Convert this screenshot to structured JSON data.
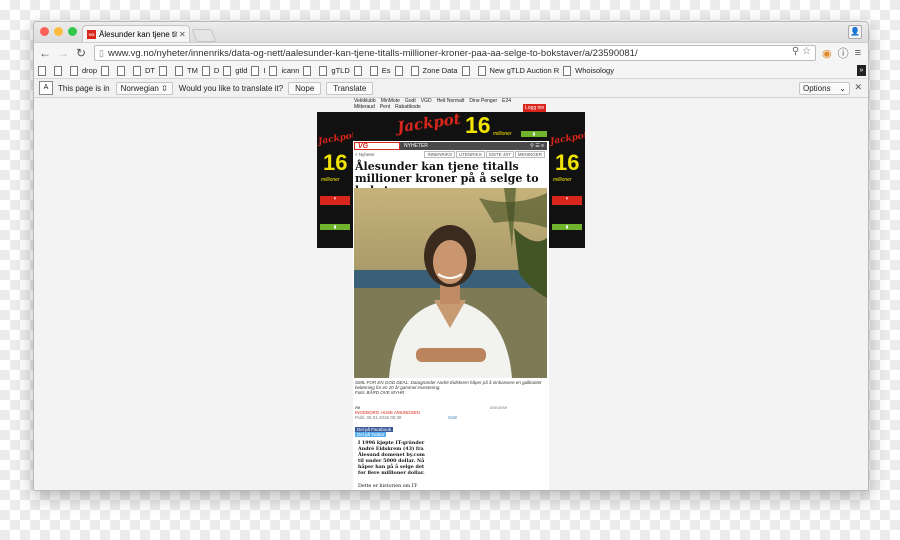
{
  "browser": {
    "tab_title": "Ålesunder kan tjene titalls",
    "tab_favicon": "VG",
    "url": "www.vg.no/nyheter/innenriks/data-og-nett/aalesunder-kan-tjene-titalls-millioner-kroner-paa-aa-selge-to-bokstaver/a/23590081/",
    "bookmarks": [
      "drop",
      "DT",
      "TM",
      "D",
      "gtld",
      "I",
      "icann",
      "gTLD",
      "Es",
      "Zone Data",
      "New gTLD Auction R",
      "Whoisology"
    ]
  },
  "translate_bar": {
    "prefix": "This page is in",
    "language": "Norwegian",
    "question": "Would you like to translate it?",
    "nope": "Nope",
    "translate": "Translate",
    "options": "Options"
  },
  "vg_top": {
    "row1": [
      "Vektklubb",
      "MinMote",
      "Godt",
      "VGD",
      "Helt Normalt",
      "Dine Penger",
      "E24"
    ],
    "row2": [
      "Mitteraud",
      "Pent",
      "Rabattkode"
    ],
    "login": "Logg inn"
  },
  "ad": {
    "jackpot": "Jackpot",
    "amount": "16",
    "unit": "millioner",
    "side_amount": "16",
    "side_unit": "millioner"
  },
  "article": {
    "section": "NYHETER",
    "back": "< Nyheter",
    "tabs": [
      "INNENRIKS",
      "UTENRIKS",
      "SISTE 48T",
      "MENINGER"
    ],
    "headline": "Ålesunder kan tjene titalls millioner kroner på å selge to bokstaver",
    "caption": "SMIL FOR EN GOD DEAL: Datagründer André Eidskrem håper på å innkassere en gullkantet belønning for en 20 år gammel investering.",
    "photo_credit": "Foto: BÅRD OVE MYHR",
    "byline_prefix": "Av",
    "author": "INGEBORG HUSE AMUNDSEN",
    "date": "Publ. 06.01.2016 05:38",
    "comment_count": "18",
    "annonse": "annonse",
    "share_facebook": "Del på Facebook",
    "share_twitter": "Del på Twitter",
    "lead": "I 1996 kjøpte IT-gründer André Eidskrem (43) fra Ålesund domenet by.com til under 5000 dollar. Nå håper han på å selge det for flere millioner dollar.",
    "body_start": "Dette er historien om IT-"
  },
  "colors": {
    "vg_red": "#d9261c",
    "ad_yellow": "#f0e400",
    "page_bg": "#f3f3f3"
  }
}
